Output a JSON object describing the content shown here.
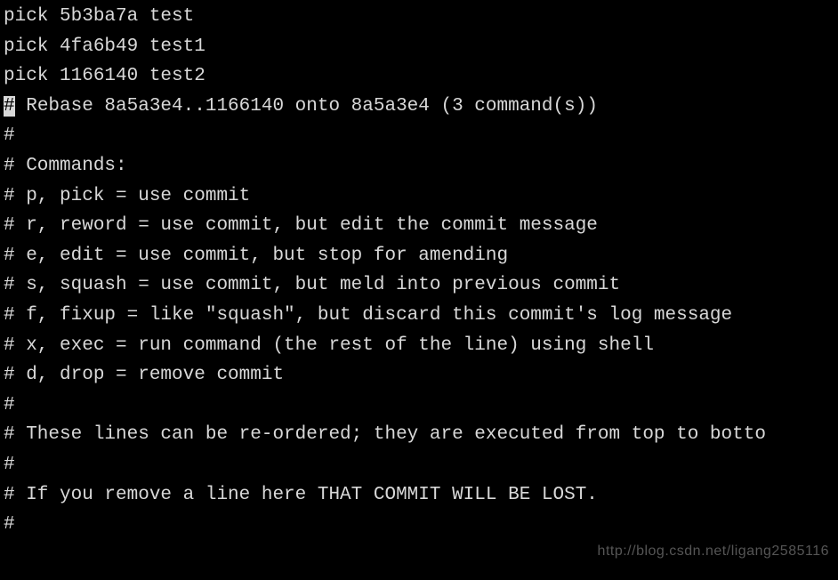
{
  "lines": {
    "l1": "pick 5b3ba7a test",
    "l2": "pick 4fa6b49 test1",
    "l3": "pick 1166140 test2",
    "l4": "",
    "l5_cursor": "#",
    "l5_rest": " Rebase 8a5a3e4..1166140 onto 8a5a3e4 (3 command(s))",
    "l6": "#",
    "l7": "# Commands:",
    "l8": "# p, pick = use commit",
    "l9": "# r, reword = use commit, but edit the commit message",
    "l10": "# e, edit = use commit, but stop for amending",
    "l11": "# s, squash = use commit, but meld into previous commit",
    "l12": "# f, fixup = like \"squash\", but discard this commit's log message",
    "l13": "# x, exec = run command (the rest of the line) using shell",
    "l14": "# d, drop = remove commit",
    "l15": "#",
    "l16": "# These lines can be re-ordered; they are executed from top to botto",
    "l17": "#",
    "l18": "# If you remove a line here THAT COMMIT WILL BE LOST.",
    "l19": "#"
  },
  "watermark": "http://blog.csdn.net/ligang2585116"
}
